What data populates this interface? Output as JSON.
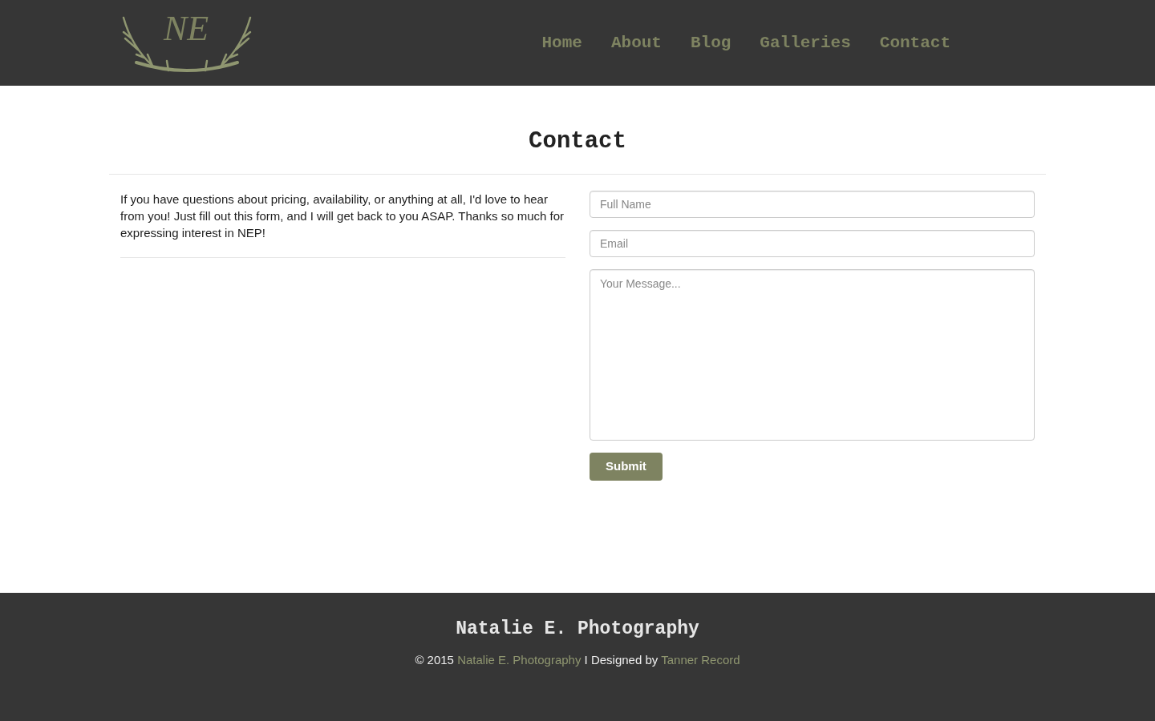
{
  "header": {
    "logo_text": "NE",
    "nav": [
      "Home",
      "About",
      "Blog",
      "Galleries",
      "Contact"
    ]
  },
  "page_title": "Contact",
  "intro": "If you have questions about pricing, availability, or anything at all, I'd love to hear from you! Just fill out this form, and I will get back to you ASAP. Thanks so much for expressing interest in NEP!",
  "form": {
    "fields": [
      {
        "kind": "input",
        "placeholder": "Full Name"
      },
      {
        "kind": "input",
        "placeholder": "Email"
      },
      {
        "kind": "textarea",
        "placeholder": "Your Message..."
      }
    ],
    "submit": "Submit"
  },
  "footer": {
    "title": "Natalie E. Photography",
    "copyright": "© 2015",
    "site_link": "Natalie E. Photography",
    "separator": "I Designed by",
    "designer_link": "Tanner Record"
  }
}
